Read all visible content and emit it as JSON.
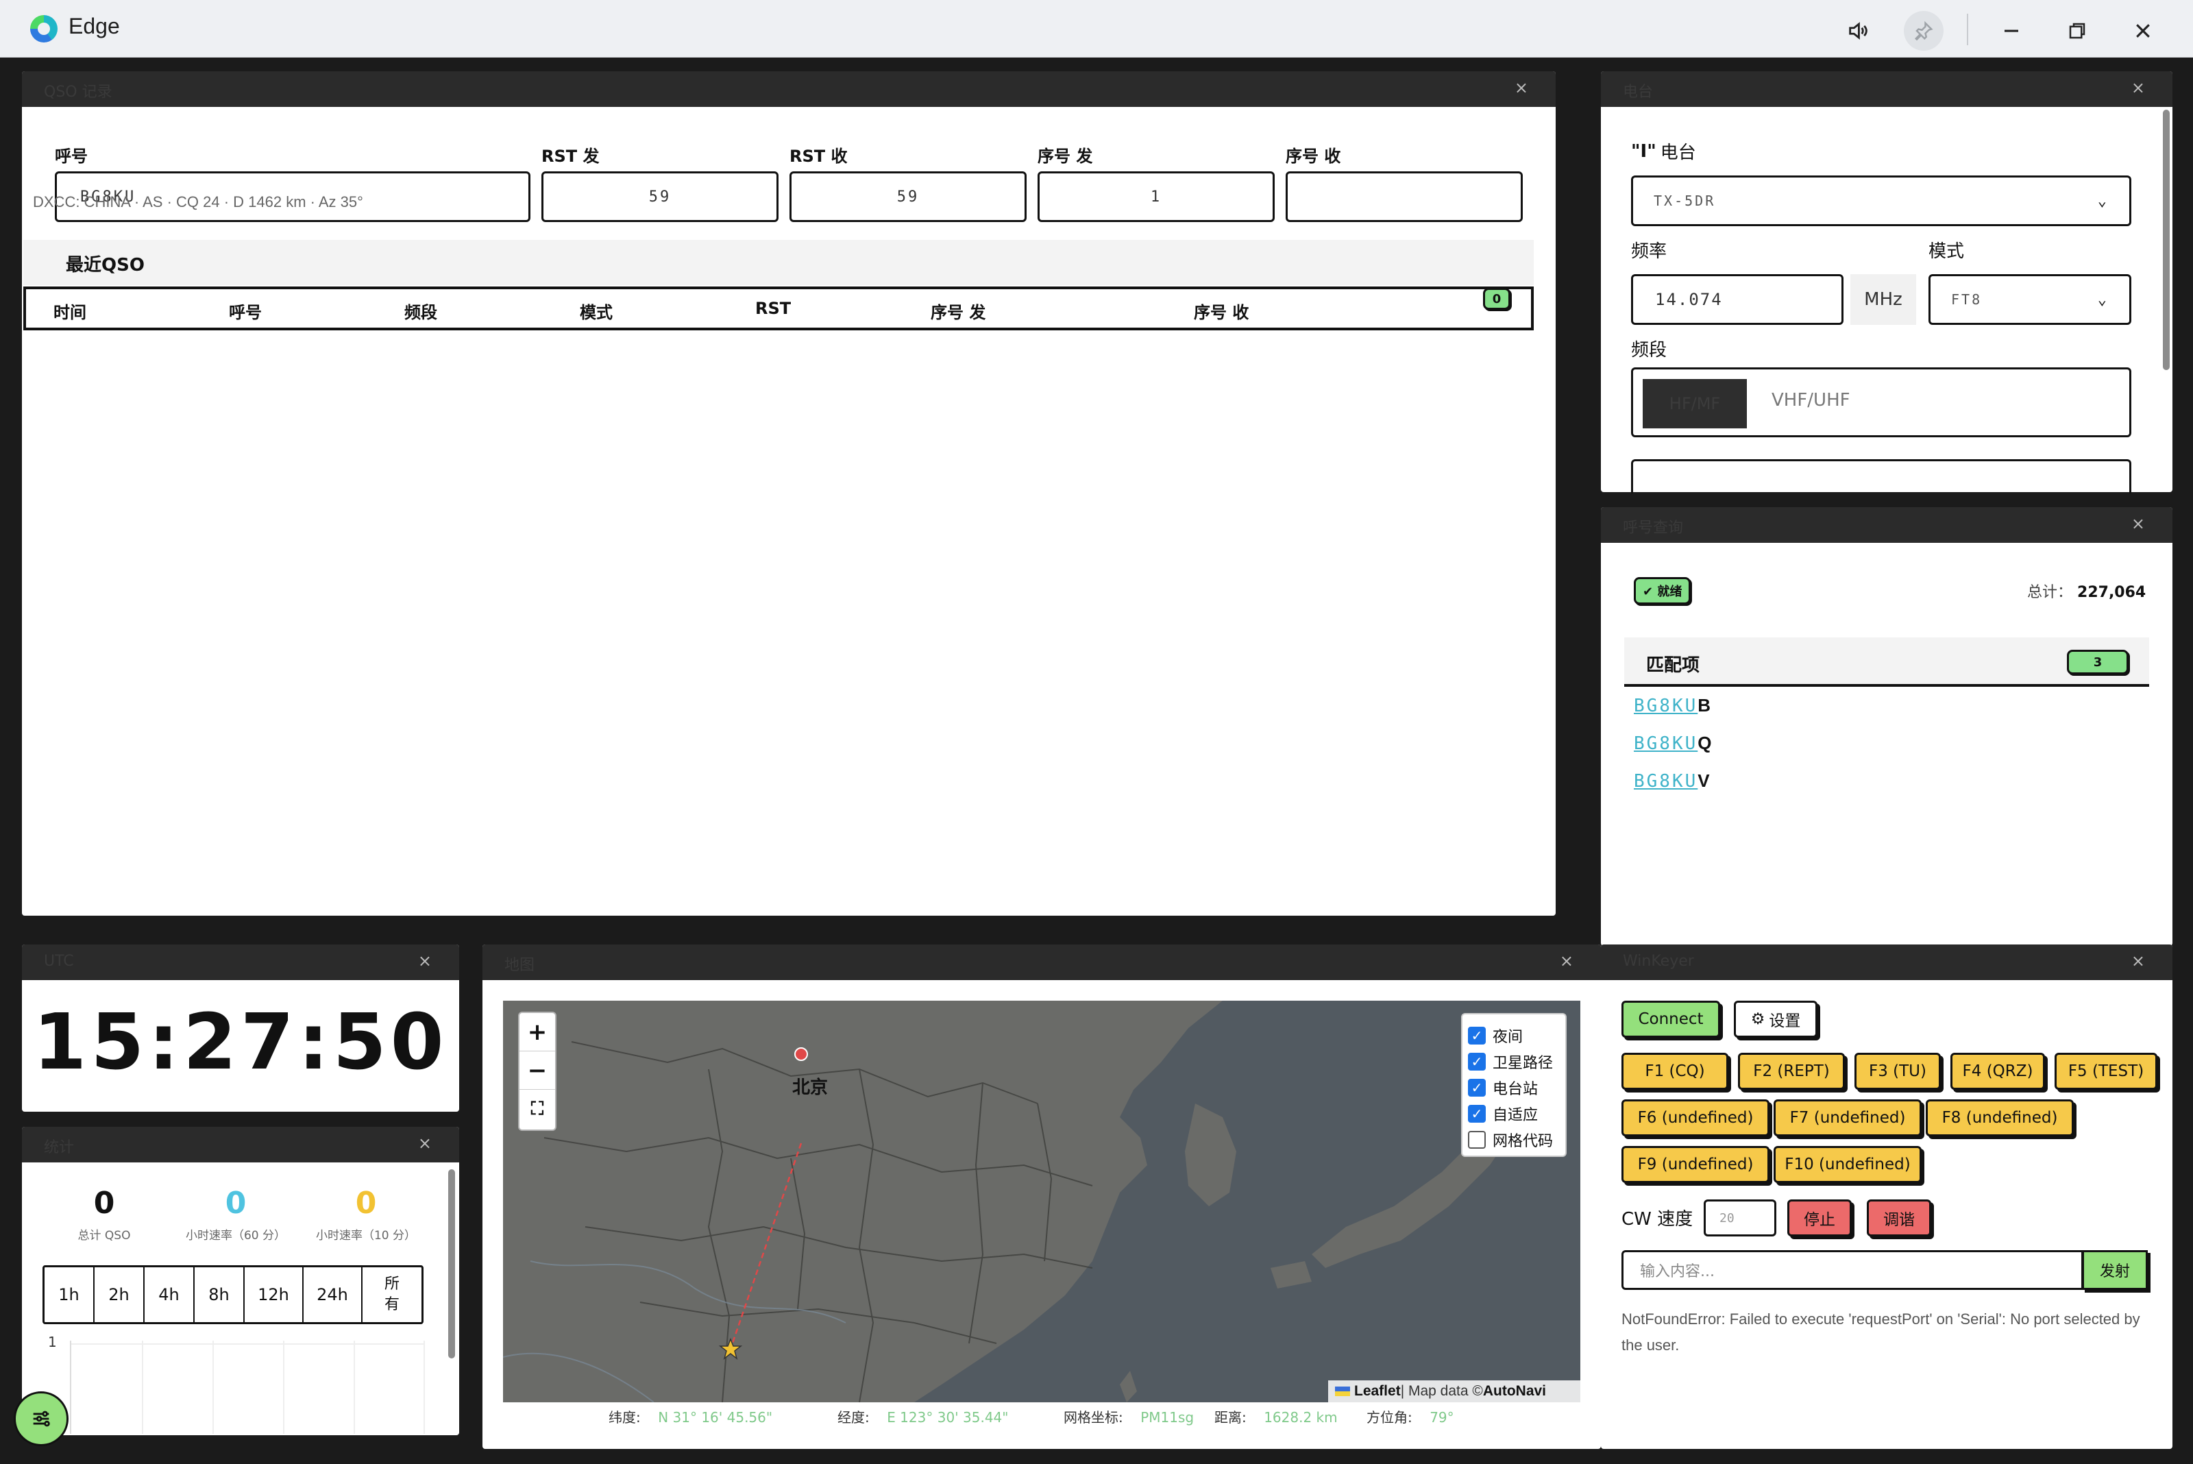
{
  "window": {
    "title": "Edge"
  },
  "qso_panel": {
    "title": "QSO 记录",
    "fields": [
      {
        "label": "呼号",
        "value": "BG8KU"
      },
      {
        "label": "RST 发",
        "value": "59"
      },
      {
        "label": "RST 收",
        "value": "59"
      },
      {
        "label": "序号 发",
        "value": "1"
      },
      {
        "label": "序号 收",
        "value": ""
      }
    ],
    "dxcc_info": "DXCC: CHINA · AS · CQ 24 · D 1462 km · Az 35°",
    "recent_title": "最近QSO",
    "recent_count": "0",
    "columns": [
      "时间",
      "呼号",
      "频段",
      "模式",
      "RST",
      "序号 发",
      "序号 收"
    ]
  },
  "radio_panel": {
    "title": "电台",
    "radio_label": "电台",
    "radio_value": "TX-5DR",
    "freq_label": "频率",
    "freq_value": "14.074",
    "freq_unit": "MHz",
    "mode_label": "模式",
    "mode_value": "FT8",
    "band_label": "频段",
    "bands": [
      "HF/MF",
      "VHF/UHF"
    ]
  },
  "lookup_panel": {
    "title": "呼号查询",
    "status": "就绪",
    "total_label": "总计：",
    "total_value": "227,064",
    "match_title": "匹配项",
    "match_count": "3",
    "matches": [
      {
        "prefix": "BG8KU",
        "suffix": "B"
      },
      {
        "prefix": "BG8KU",
        "suffix": "Q"
      },
      {
        "prefix": "BG8KU",
        "suffix": "V"
      }
    ]
  },
  "utc_panel": {
    "title": "UTC",
    "time": "15:27:50"
  },
  "stats_panel": {
    "title": "统计",
    "stats": [
      {
        "value": "0",
        "label": "总计 QSO",
        "color": "#111111"
      },
      {
        "value": "0",
        "label": "小时速率（60 分）",
        "color": "#4fc3e0"
      },
      {
        "value": "0",
        "label": "小时速率（10 分）",
        "color": "#f2c232"
      }
    ],
    "ranges": [
      "1h",
      "2h",
      "4h",
      "8h",
      "12h",
      "24h",
      "所有"
    ],
    "chart_y_tick": "1"
  },
  "map_panel": {
    "title": "地图",
    "city_label": "北京",
    "zoom_in": "+",
    "zoom_out": "−",
    "layers": [
      {
        "label": "夜间",
        "checked": true
      },
      {
        "label": "卫星路径",
        "checked": true
      },
      {
        "label": "电台站",
        "checked": true
      },
      {
        "label": "自适应",
        "checked": true
      },
      {
        "label": "网格代码",
        "checked": false
      }
    ],
    "attribution": {
      "leaflet": "Leaflet",
      "text": " | Map data © ",
      "provider": "AutoNavi"
    },
    "info": [
      {
        "label": "纬度:",
        "value": "N 31° 16' 45.56\""
      },
      {
        "label": "经度:",
        "value": "E 123° 30' 35.44\""
      },
      {
        "label": "网格坐标:",
        "value": "PM11sg"
      },
      {
        "label": "距离:",
        "value": "1628.2 km"
      },
      {
        "label": "方位角:",
        "value": "79°"
      }
    ]
  },
  "winkeyer_panel": {
    "title": "WinKeyer",
    "connect_label": "Connect",
    "settings_label": "设置",
    "fkeys": [
      "F1 (CQ)",
      "F2 (REPT)",
      "F3 (TU)",
      "F4 (QRZ)",
      "F5 (TEST)",
      "F6 (undefined)",
      "F7 (undefined)",
      "F8 (undefined)",
      "F9 (undefined)",
      "F10 (undefined)"
    ],
    "cw_speed_label": "CW 速度",
    "cw_speed_placeholder": "20",
    "stop_label": "停止",
    "tune_label": "调谐",
    "input_placeholder": "输入内容...",
    "send_label": "发射",
    "error": "NotFoundError: Failed to execute 'requestPort' on 'Serial': No port selected by the user."
  },
  "colors": {
    "accent_green": "#94e07c",
    "fkey_yellow": "#f6c94a",
    "danger_red": "#ec6a6a",
    "link_cyan": "#3fb3c9"
  },
  "icons": [
    "speaker-icon",
    "pin-icon",
    "minimize-icon",
    "restore-icon",
    "close-icon",
    "chevron-down-icon",
    "antenna-icon",
    "gear-icon",
    "check-icon",
    "sliders-icon"
  ]
}
